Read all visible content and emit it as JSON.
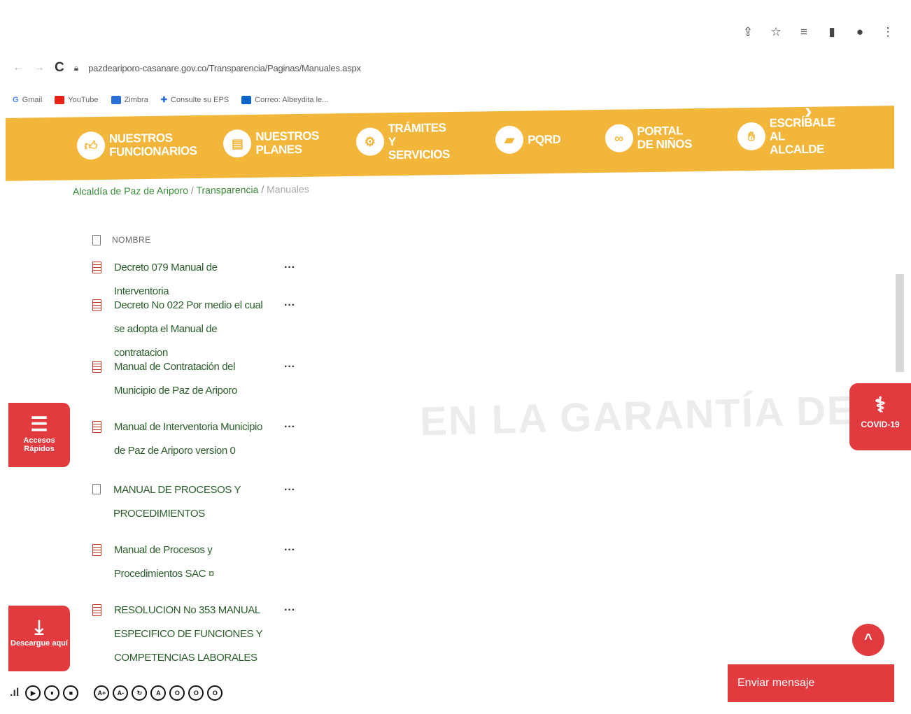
{
  "browser": {
    "url": "pazdeariporo-casanare.gov.co/Transparencia/Paginas/Manuales.aspx",
    "bookmarks": [
      "Gmail",
      "YouTube",
      "Zimbra",
      "Consulte su EPS",
      "Correo: Albeydita le..."
    ]
  },
  "nav": {
    "items": [
      {
        "label": "NUESTROS FUNCIONARIOS",
        "icon": "thumbs-up-icon"
      },
      {
        "label": "NUESTROS PLANES",
        "icon": "document-icon"
      },
      {
        "label": "TRÁMITES Y SERVICIOS",
        "icon": "gears-icon"
      },
      {
        "label": "PQRD",
        "icon": "folder-icon"
      },
      {
        "label": "PORTAL DE NIÑOS",
        "icon": "glasses-icon"
      },
      {
        "label": "ESCRÍBALE AL ALCALDE",
        "icon": "hand-icon"
      }
    ]
  },
  "breadcrumb": {
    "home": "Alcaldía de Paz de Ariporo",
    "section": "Transparencia",
    "current": "Manuales"
  },
  "list": {
    "header": "NOMBRE",
    "items": [
      {
        "name": "Decreto 079 Manual de Interventoria",
        "type": "pdf"
      },
      {
        "name": "Decreto No 022 Por medio el cual se adopta el Manual de contratacion",
        "type": "pdf"
      },
      {
        "name": "Manual de Contratación del Municipio de Paz de Ariporo",
        "type": "pdf"
      },
      {
        "name": "Manual de Interventoria Municipio de Paz de Ariporo version 0",
        "type": "pdf"
      },
      {
        "name": "MANUAL DE PROCESOS Y PROCEDIMIENTOS",
        "type": "doc"
      },
      {
        "name": "Manual de Procesos y Procedimientos SAC ¤",
        "type": "pdf"
      },
      {
        "name": "RESOLUCION No 353 MANUAL ESPECIFICO DE FUNCIONES Y COMPETENCIAS LABORALES",
        "type": "pdf"
      }
    ],
    "more": "···"
  },
  "side": {
    "quick_access": "Accesos Rápidos",
    "download": "Descargue aquí",
    "covid": "COVID-19"
  },
  "chat": {
    "label": "Enviar mensaje"
  },
  "background_text": [
    "EN LA GARANTÍA DE LA"
  ],
  "colors": {
    "brand_yellow": "#f2b63a",
    "brand_red": "#e23b3f",
    "link_green": "#2c5e2c"
  },
  "a11y": {
    "buttons": [
      "▶",
      "⏸",
      "■",
      "A+",
      "A-",
      "↻",
      "A",
      "O",
      "O",
      "O"
    ]
  }
}
